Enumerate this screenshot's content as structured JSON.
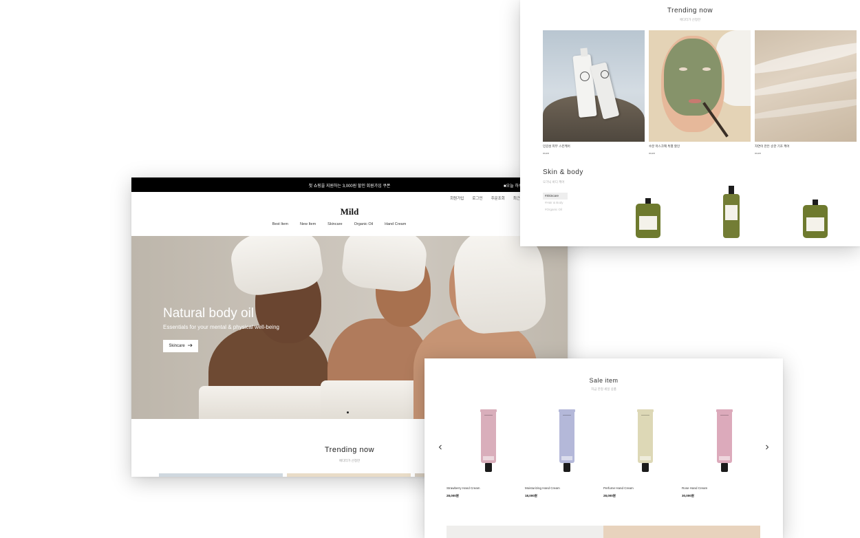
{
  "main": {
    "topbar": {
      "promo": "첫 쇼핑을 지원하는 3,000원 할인 회원가입 쿠폰",
      "today": "■오늘 하루"
    },
    "util_links": [
      "회원가입",
      "로그인",
      "주문조회",
      "최근본"
    ],
    "logo": "Mild",
    "nav": [
      "Best Item",
      "New Item",
      "Skincare",
      "Organic Oil",
      "Hand Cream"
    ],
    "hero": {
      "title": "Natural body oil",
      "subtitle": "Essentials for your mental & physical well-being",
      "button": "Skincare",
      "button_icon": "arrow-right-icon"
    },
    "trending": {
      "title": "Trending now",
      "subtitle": "에디터가 선정한"
    }
  },
  "trend_panel": {
    "title": "Trending now",
    "subtitle": "에디터가 선정한",
    "cards": [
      {
        "caption": "민감성 피부 스킨케어",
        "more": "more"
      },
      {
        "caption": "수분 마스크팩 특별 할인",
        "more": "more"
      },
      {
        "caption": "자연이 만든 순한 기초 케어",
        "more": "more"
      }
    ],
    "skin_body": {
      "title": "Skin & body",
      "subtitle": "오가닉 바디 케어",
      "tabs": [
        "#Skincare",
        "#Hair & Body",
        "#Organic Oil"
      ]
    }
  },
  "sale_panel": {
    "title": "Sale item",
    "subtitle": "지금 한정 세일 상품",
    "prev_icon": "chevron-left-icon",
    "next_icon": "chevron-right-icon",
    "products": [
      {
        "name": "Strawberry Hand Cream",
        "price": "28,000원",
        "color": "#d9aebb"
      },
      {
        "name": "Moisturizing Hand Cream",
        "price": "18,000원",
        "color": "#b4b8d9"
      },
      {
        "name": "Perfume Hand Cream",
        "price": "28,000원",
        "color": "#ddd8b6"
      },
      {
        "name": "Rose Hand Cream",
        "price": "30,000원",
        "color": "#dcaabb"
      }
    ]
  }
}
